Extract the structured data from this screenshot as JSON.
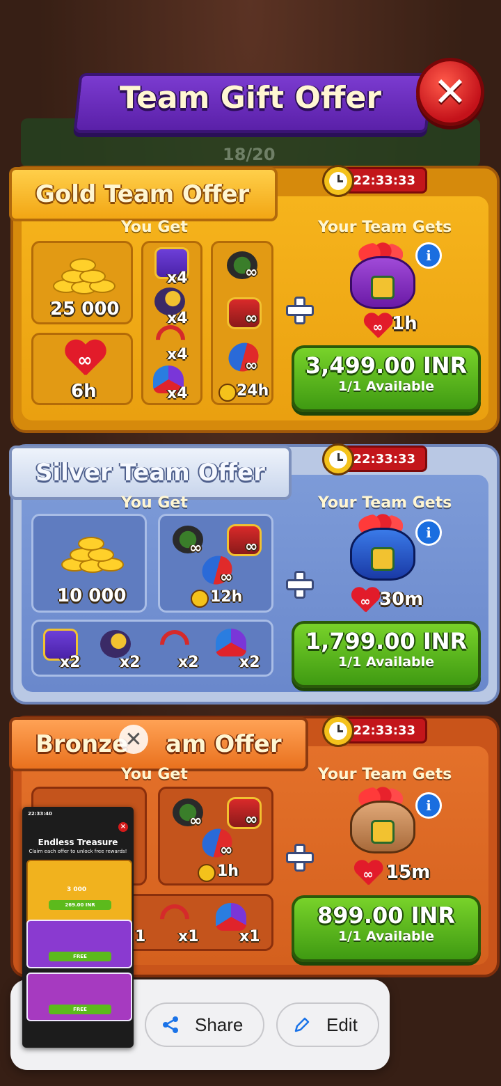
{
  "header": {
    "title": "Team Gift Offer",
    "close_icon": "close-icon"
  },
  "background": {
    "team_count": "18/20"
  },
  "offers": [
    {
      "tier": "gold",
      "title": "Gold Team Offer",
      "timer": "22:33:33",
      "you_get_label": "You Get",
      "team_gets_label": "Your Team Gets",
      "coins": "25 000",
      "lives_duration": "6h",
      "boosters": [
        {
          "icon": "chest-icon",
          "qty": "x4"
        },
        {
          "icon": "cannon-icon",
          "qty": "x4"
        },
        {
          "icon": "bow-icon",
          "qty": "x4"
        },
        {
          "icon": "jester-hat-icon",
          "qty": "x4"
        }
      ],
      "infinite_boosters": [
        "candy-ball-icon",
        "drum-icon",
        "rocket-icon"
      ],
      "infinite_duration": "24h",
      "team_reward_duration": "1h",
      "price": "3,499.00 INR",
      "availability": "1/1 Available"
    },
    {
      "tier": "silver",
      "title": "Silver Team Offer",
      "timer": "22:33:33",
      "you_get_label": "You Get",
      "team_gets_label": "Your Team Gets",
      "coins": "10 000",
      "infinite_duration": "12h",
      "boosters": [
        {
          "icon": "chest-icon",
          "qty": "x2"
        },
        {
          "icon": "cannon-icon",
          "qty": "x2"
        },
        {
          "icon": "bow-icon",
          "qty": "x2"
        },
        {
          "icon": "jester-hat-icon",
          "qty": "x2"
        }
      ],
      "team_reward_duration": "30m",
      "price": "1,799.00 INR",
      "availability": "1/1 Available"
    },
    {
      "tier": "bronze",
      "title_left": "Bronze",
      "title_right": "am Offer",
      "timer": "22:33:33",
      "you_get_label": "You Get",
      "team_gets_label": "Your Team Gets",
      "infinite_duration": "1h",
      "boosters": [
        {
          "icon": "bow-icon",
          "qty": "x1"
        },
        {
          "icon": "jester-hat-icon",
          "qty": "x1"
        }
      ],
      "partial_qty": "1",
      "team_reward_duration": "15m",
      "price": "899.00 INR",
      "availability": "1/1 Available"
    }
  ],
  "screenshot_overlay": {
    "thumbnail": {
      "timer": "22:33:40",
      "title": "Endless Treasure",
      "subtitle": "Claim each offer to unlock free rewards!",
      "coins": "3 000",
      "price": "269.00 INR",
      "free_label_1": "FREE",
      "free_label_2": "FREE"
    },
    "share_label": "Share",
    "edit_label": "Edit"
  }
}
